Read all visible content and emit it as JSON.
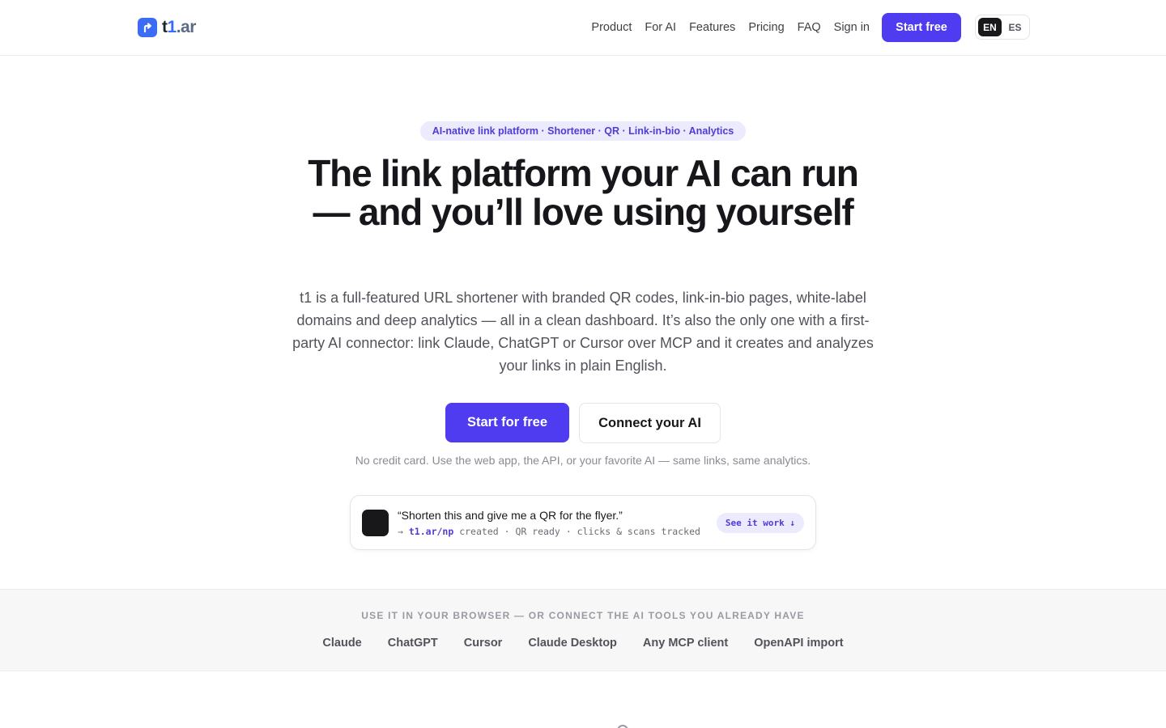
{
  "nav": {
    "logo": {
      "t": "t",
      "one": "1",
      "dot": ".ar"
    },
    "links": [
      "Product",
      "For AI",
      "Features",
      "Pricing",
      "FAQ",
      "Sign in"
    ],
    "cta": "Start free",
    "languages": [
      "EN",
      "ES"
    ],
    "active_language": "EN"
  },
  "hero": {
    "pill": "AI-native link platform · Shortener · QR · Link-in-bio · Analytics",
    "headline": "The link platform your AI can run — and you’ll love using yourself",
    "subtitle": "t1 is a full-featured URL shortener with branded QR codes, link-in-bio pages, white-label domains and deep analytics — all in a clean dashboard. It’s also the only one with a first-party AI connector: link Claude, ChatGPT or Cursor over MCP and it creates and analyzes your links in plain English.",
    "primary_cta": "Start for free",
    "secondary_cta": "Connect your AI",
    "note": "No credit card. Use the web app, the API, or your favorite AI — same links, same analytics."
  },
  "demo": {
    "quote": "“Shorten this and give me a QR for the flyer.”",
    "arrow": "→",
    "link": "t1.ar/np",
    "result_rest": "created · QR ready · clicks & scans tracked",
    "button": "See it work ↓"
  },
  "integrations": {
    "title": "USE IT IN YOUR BROWSER — OR CONNECT THE AI TOOLS YOU ALREADY HAVE",
    "items": [
      "Claude",
      "ChatGPT",
      "Cursor",
      "Claude Desktop",
      "Any MCP client",
      "OpenAPI import"
    ]
  },
  "colors": {
    "brand": "#4f3cf0",
    "logo": "#3b6cf4"
  }
}
